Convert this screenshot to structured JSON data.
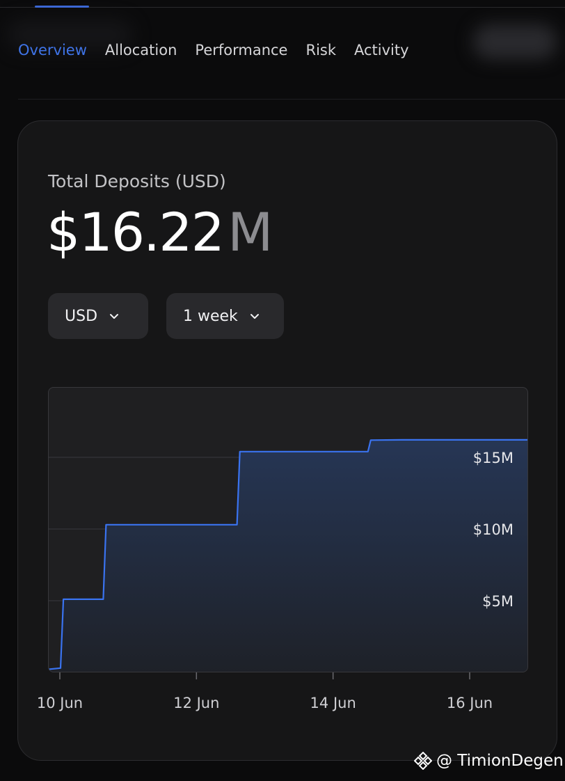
{
  "tabs": [
    {
      "label": "Overview",
      "active": true
    },
    {
      "label": "Allocation",
      "active": false
    },
    {
      "label": "Performance",
      "active": false
    },
    {
      "label": "Risk",
      "active": false
    },
    {
      "label": "Activity",
      "active": false
    }
  ],
  "card": {
    "label": "Total Deposits (USD)",
    "value": "$16.22",
    "unit": "M",
    "currency_select": "USD",
    "period_select": "1 week"
  },
  "chart_data": {
    "type": "area",
    "x": [
      "2024-06-09T19:00",
      "2024-06-10T00:00",
      "2024-06-10T01:00",
      "2024-06-10T15:00",
      "2024-06-10T16:00",
      "2024-06-12T14:00",
      "2024-06-12T15:00",
      "2024-06-14T12:00",
      "2024-06-14T13:00",
      "2024-06-15T00:00",
      "2024-06-16T20:00"
    ],
    "y": [
      0.2,
      0.3,
      5.1,
      5.1,
      10.3,
      10.3,
      15.4,
      15.4,
      16.2,
      16.22,
      16.22
    ],
    "xticks": [
      "10 Jun",
      "12 Jun",
      "14 Jun",
      "16 Jun"
    ],
    "yticks": [
      "$5M",
      "$10M",
      "$15M"
    ],
    "ylim": [
      0,
      20
    ],
    "line_color": "#3a73f0",
    "fill_color": "#263655",
    "grid": true
  },
  "colors": {
    "accent": "#3f74e8",
    "background": "#0b0b0c",
    "card": "#161617"
  },
  "watermark": {
    "text": "@ TimionDegen",
    "icon": "binance-logo-icon"
  }
}
